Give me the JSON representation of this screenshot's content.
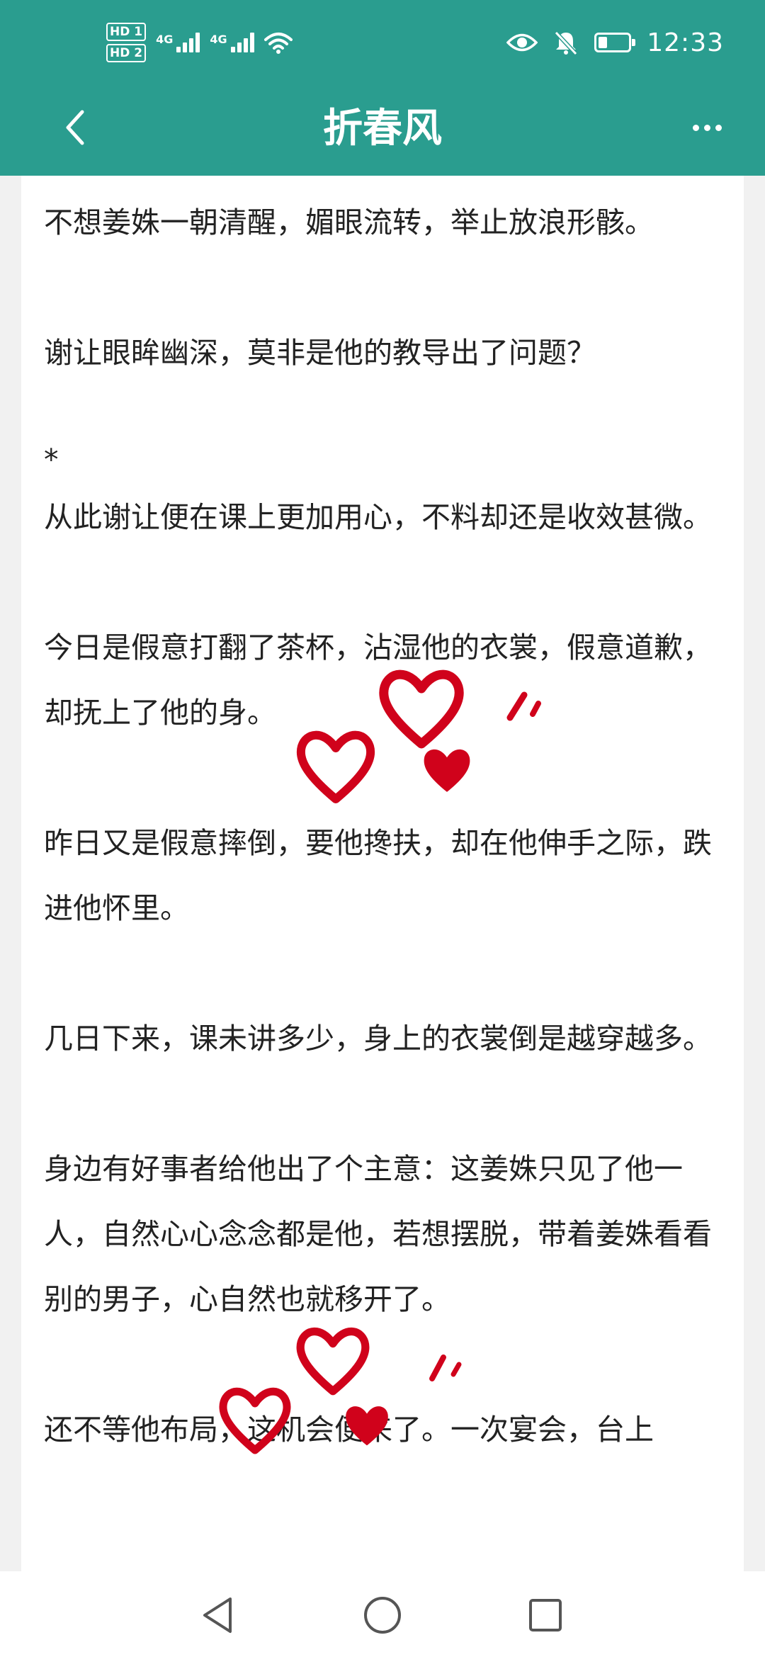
{
  "status_bar": {
    "time": "12:33",
    "sim1_label": "HD 1",
    "sim2_label": "HD 2",
    "network1": "4G",
    "network2": "4G",
    "battery_level": 0.3,
    "icons": [
      "eye-icon",
      "bell-muted-icon",
      "battery-icon",
      "wifi-icon",
      "signal-icon"
    ]
  },
  "app_bar": {
    "title": "折春风",
    "back_icon": "chevron-left-icon",
    "more_icon": "more-dots-icon"
  },
  "content": {
    "paragraphs": [
      "不想姜姝一朝清醒，媚眼流转，举止放浪形骸。",
      "谢让眼眸幽深，莫非是他的教导出了问题？",
      "*",
      "从此谢让便在课上更加用心，不料却还是收效甚微。",
      "今日是假意打翻了茶杯，沾湿他的衣裳，假意道歉，却抚上了他的身。",
      "昨日又是假意摔倒，要他搀扶，却在他伸手之际，跌进他怀里。",
      "几日下来，课未讲多少，身上的衣裳倒是越穿越多。",
      "身边有好事者给他出了个主意：这姜姝只见了他一人，自然心心念念都是他，若想摆脱，带着姜姝看看别的男子，心自然也就移开了。",
      "还不等他布局，这机会便来了。一次宴会，台上"
    ]
  },
  "decorations": {
    "heart_color": "#d0021b"
  },
  "colors": {
    "header": "#2a9d8f",
    "text": "#222222",
    "background": "#f1f1f1"
  },
  "nav_bar": {
    "icons": [
      "back-triangle-icon",
      "home-circle-icon",
      "recents-square-icon"
    ]
  }
}
